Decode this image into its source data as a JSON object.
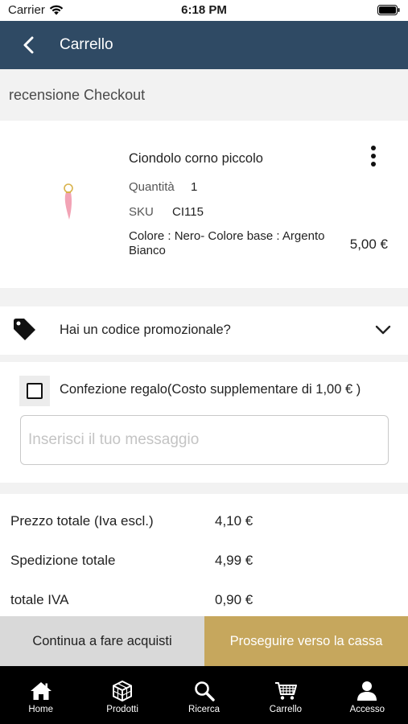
{
  "status_bar": {
    "carrier": "Carrier",
    "time": "6:18 PM"
  },
  "header": {
    "title": "Carrello",
    "back_icon": "chevron-left-icon"
  },
  "section_title": "recensione Checkout",
  "product": {
    "name": "Ciondolo corno piccolo",
    "quantity_label": "Quantità",
    "quantity_value": "1",
    "sku_label": "SKU",
    "sku_value": "CI115",
    "variant": "Colore : Nero- Colore base : Argento Bianco",
    "price": "5,00 €",
    "menu_icon": "more-vertical-icon"
  },
  "promo": {
    "label": "Hai un codice promozionale?",
    "icon": "tag-icon"
  },
  "gift": {
    "label": "Confezione regalo(Costo supplementare di 1,00 € )",
    "message_placeholder": "Inserisci il tuo messaggio",
    "message_value": ""
  },
  "totals": [
    {
      "label": "Prezzo totale (Iva escl.)",
      "value": "4,10 €"
    },
    {
      "label": "Spedizione totale",
      "value": "4,99 €"
    },
    {
      "label": "totale IVA",
      "value": "0,90 €"
    }
  ],
  "actions": {
    "continue_label": "Continua a fare acquisti",
    "checkout_label": "Proseguire verso la cassa"
  },
  "tab_bar": [
    {
      "label": "Home",
      "icon": "home-icon"
    },
    {
      "label": "Prodotti",
      "icon": "cube-icon"
    },
    {
      "label": "Ricerca",
      "icon": "search-icon"
    },
    {
      "label": "Carrello",
      "icon": "cart-icon"
    },
    {
      "label": "Accesso",
      "icon": "user-icon"
    }
  ],
  "colors": {
    "header_bg": "#2f4a64",
    "checkout_button": "#c6a75d",
    "continue_button": "#d9d9d9",
    "tab_bar_bg": "#000000",
    "page_bg": "#f2f2f2"
  }
}
